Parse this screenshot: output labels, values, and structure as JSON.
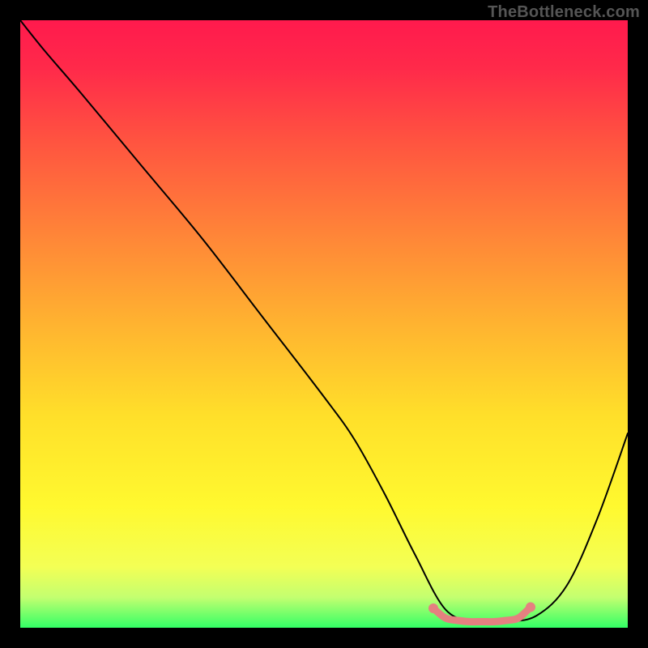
{
  "watermark": "TheBottleneck.com",
  "chart_data": {
    "type": "line",
    "title": "",
    "xlabel": "",
    "ylabel": "",
    "xlim": [
      0,
      100
    ],
    "ylim": [
      0,
      100
    ],
    "grid": false,
    "series": [
      {
        "name": "curve",
        "x": [
          0,
          4,
          10,
          20,
          30,
          40,
          50,
          55,
          60,
          65,
          70,
          75,
          80,
          85,
          90,
          95,
          100
        ],
        "y": [
          100,
          95,
          88,
          76,
          64,
          51,
          38,
          31,
          22,
          12,
          3,
          1,
          1,
          2,
          7,
          18,
          32
        ]
      }
    ],
    "highlight": {
      "name": "flat-marker-region",
      "color": "#e58080",
      "x": [
        68,
        70,
        72,
        74,
        76,
        78,
        80,
        82,
        84
      ],
      "y": [
        3.2,
        1.6,
        1.2,
        1.0,
        1.0,
        1.0,
        1.2,
        1.6,
        3.4
      ]
    },
    "gradient_stops": [
      {
        "offset": 0.0,
        "color": "#ff1a4d"
      },
      {
        "offset": 0.08,
        "color": "#ff2a4a"
      },
      {
        "offset": 0.2,
        "color": "#ff5440"
      },
      {
        "offset": 0.35,
        "color": "#ff8438"
      },
      {
        "offset": 0.5,
        "color": "#ffb330"
      },
      {
        "offset": 0.65,
        "color": "#ffdf2a"
      },
      {
        "offset": 0.8,
        "color": "#fff92f"
      },
      {
        "offset": 0.9,
        "color": "#f3ff55"
      },
      {
        "offset": 0.95,
        "color": "#c3ff70"
      },
      {
        "offset": 1.0,
        "color": "#33ff66"
      }
    ]
  }
}
